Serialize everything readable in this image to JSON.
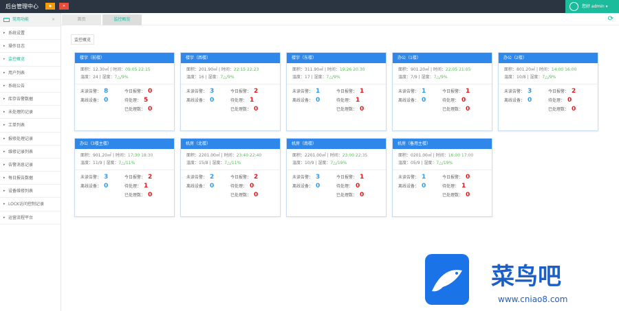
{
  "header": {
    "title": "后台管理中心",
    "btn1": "◆",
    "btn2": "✕",
    "user": "您好 admin ▾"
  },
  "sidebar": {
    "head": "常用功能",
    "items": [
      "系统设置",
      "操作日志",
      "监控概览",
      "用户列表",
      "系统公告",
      "库存告警数据",
      "未处理的记录",
      "工单列表",
      "报修处理记录",
      "维修记录列表",
      "告警消息记录",
      "每日报告数据",
      "设备维修列表",
      "LOCK访问控制记录",
      "运营流程平台"
    ],
    "active": 2
  },
  "tabs": [
    "首页",
    "监控概览"
  ],
  "crumb": "监控概览",
  "labels": {
    "ip": "面积",
    "time": "时间",
    "temp": "温度",
    "hum": "湿度",
    "s1": "未读告警",
    "s2": "离线设备",
    "s3": "今日报警",
    "s4": "待处理",
    "s5": "已处理数"
  },
  "cards": [
    {
      "title": "楼宇（前楼）",
      "ip": "12.30㎡",
      "time": "09:05 22:15",
      "temp": "24",
      "hum": "7△/9%",
      "a": "8",
      "b": "0",
      "c": "0",
      "d": "5",
      "e": "0"
    },
    {
      "title": "楼宇（西楼）",
      "ip": "201.90㎡",
      "time": "22:15 22:23",
      "temp": "16",
      "hum": "7△/9%",
      "a": "3",
      "b": "0",
      "c": "2",
      "d": "1",
      "e": "0"
    },
    {
      "title": "楼宇（东楼）",
      "ip": "311.90㎡",
      "time": "19:26 20:30",
      "temp": "17",
      "hum": "7△/9%",
      "a": "1",
      "b": "0",
      "c": "1",
      "d": "1",
      "e": "0"
    },
    {
      "title": "办公（1楼）",
      "ip": "901.20㎡",
      "time": "22:05 21:05",
      "temp": "7/9",
      "hum": "7△/9%",
      "a": "1",
      "b": "0",
      "c": "1",
      "d": "0",
      "e": "0"
    },
    {
      "title": "办公（2楼）",
      "ip": "801.20㎡",
      "time": "14:00 16:00",
      "temp": "10/8",
      "hum": "7△/9%",
      "a": "3",
      "b": "0",
      "c": "2",
      "d": "0",
      "e": "0"
    },
    {
      "title": "办公（3楼主楼）",
      "ip": "901.20㎡",
      "time": "17:30 18:30",
      "temp": "11/9",
      "hum": "7△/11%",
      "a": "3",
      "b": "0",
      "c": "2",
      "d": "1",
      "e": "0"
    },
    {
      "title": "机房（北楼）",
      "ip": "2201.00㎡",
      "time": "23:40 22:40",
      "temp": "15/8",
      "hum": "7△/11%",
      "a": "2",
      "b": "0",
      "c": "2",
      "d": "0",
      "e": "0"
    },
    {
      "title": "机房（南楼）",
      "ip": "2201.00㎡",
      "time": "23:00 22:35",
      "temp": "10/9",
      "hum": "7△/19%",
      "a": "3",
      "b": "0",
      "c": "1",
      "d": "0",
      "e": "0"
    },
    {
      "title": "机房（备用主楼）",
      "ip": "0201.00㎡",
      "time": "16:00 17:00",
      "temp": "05/9",
      "hum": "7△/19%",
      "a": "1",
      "b": "0",
      "c": "0",
      "d": "1",
      "e": "0"
    }
  ],
  "watermark": {
    "name": "菜鸟吧",
    "url": "www.cniao8.com"
  },
  "colors": {
    "accent": "#1abc9c",
    "card_header": "#2f87ea",
    "blue": "#2f9ae9",
    "red": "#e4191c"
  }
}
